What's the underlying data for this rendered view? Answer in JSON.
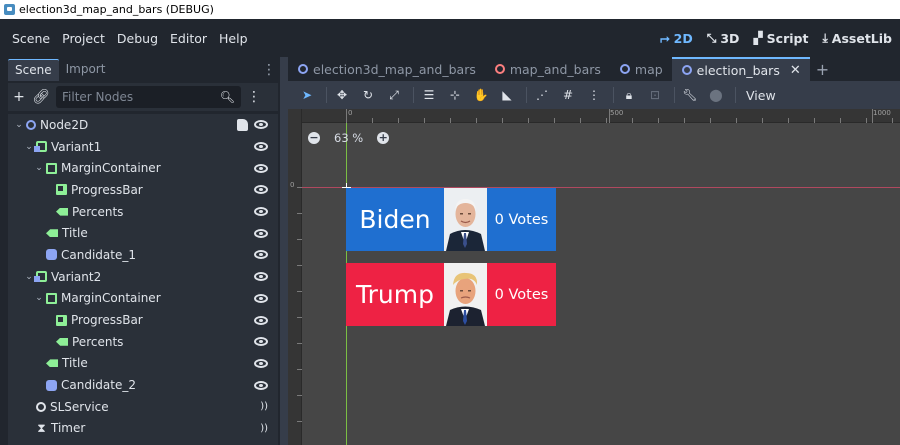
{
  "window": {
    "title": "election3d_map_and_bars (DEBUG)"
  },
  "menu": [
    "Scene",
    "Project",
    "Debug",
    "Editor",
    "Help"
  ],
  "workspaces": [
    {
      "label": "2D",
      "icon": "2d-icon",
      "active": true
    },
    {
      "label": "3D",
      "icon": "3d-icon",
      "active": false
    },
    {
      "label": "Script",
      "icon": "script-icon",
      "active": false
    },
    {
      "label": "AssetLib",
      "icon": "assetlib-icon",
      "active": false
    }
  ],
  "dock": {
    "tabs": [
      "Scene",
      "Import"
    ],
    "filter_placeholder": "Filter Nodes"
  },
  "tree": [
    {
      "label": "Node2D",
      "icon": "node2d-icon",
      "depth": 0,
      "expand": true,
      "script": true,
      "action": "eye"
    },
    {
      "label": "Variant1",
      "icon": "variant-icon",
      "depth": 1,
      "expand": true,
      "action": "eye"
    },
    {
      "label": "MarginContainer",
      "icon": "margin-container-icon",
      "depth": 2,
      "expand": true,
      "action": "eye"
    },
    {
      "label": "ProgressBar",
      "icon": "progressbar-icon",
      "depth": 3,
      "action": "eye"
    },
    {
      "label": "Percents",
      "icon": "label-icon",
      "depth": 3,
      "action": "eye"
    },
    {
      "label": "Title",
      "icon": "label-icon",
      "depth": 2,
      "action": "eye"
    },
    {
      "label": "Candidate_1",
      "icon": "sprite-icon",
      "depth": 2,
      "action": "eye"
    },
    {
      "label": "Variant2",
      "icon": "variant-icon",
      "depth": 1,
      "expand": true,
      "action": "eye"
    },
    {
      "label": "MarginContainer",
      "icon": "margin-container-icon",
      "depth": 2,
      "expand": true,
      "action": "eye"
    },
    {
      "label": "ProgressBar",
      "icon": "progressbar-icon",
      "depth": 3,
      "action": "eye"
    },
    {
      "label": "Percents",
      "icon": "label-icon",
      "depth": 3,
      "action": "eye"
    },
    {
      "label": "Title",
      "icon": "label-icon",
      "depth": 2,
      "action": "eye"
    },
    {
      "label": "Candidate_2",
      "icon": "sprite-icon",
      "depth": 2,
      "action": "eye"
    },
    {
      "label": "SLService",
      "icon": "node-icon",
      "depth": 1,
      "action": "signal"
    },
    {
      "label": "Timer",
      "icon": "timer-icon",
      "depth": 1,
      "action": "signal"
    }
  ],
  "editor_tabs": [
    {
      "label": "election3d_map_and_bars",
      "color": "#8da5f3",
      "active": false
    },
    {
      "label": "map_and_bars",
      "color": "#fc7f7f",
      "active": false
    },
    {
      "label": "map",
      "color": "#8da5f3",
      "active": false
    },
    {
      "label": "election_bars",
      "color": "#8da5f3",
      "active": true
    }
  ],
  "toolbar": {
    "view_label": "View"
  },
  "viewport": {
    "zoom": "63 %",
    "ruler_labels": {
      "h0": "0",
      "h500": "500",
      "h1000": "1000",
      "v0": "0"
    },
    "candidates": [
      {
        "name": "Biden",
        "votes": "0 Votes",
        "color": "#1f6fd0"
      },
      {
        "name": "Trump",
        "votes": "0 Votes",
        "color": "#ee2244"
      }
    ]
  }
}
